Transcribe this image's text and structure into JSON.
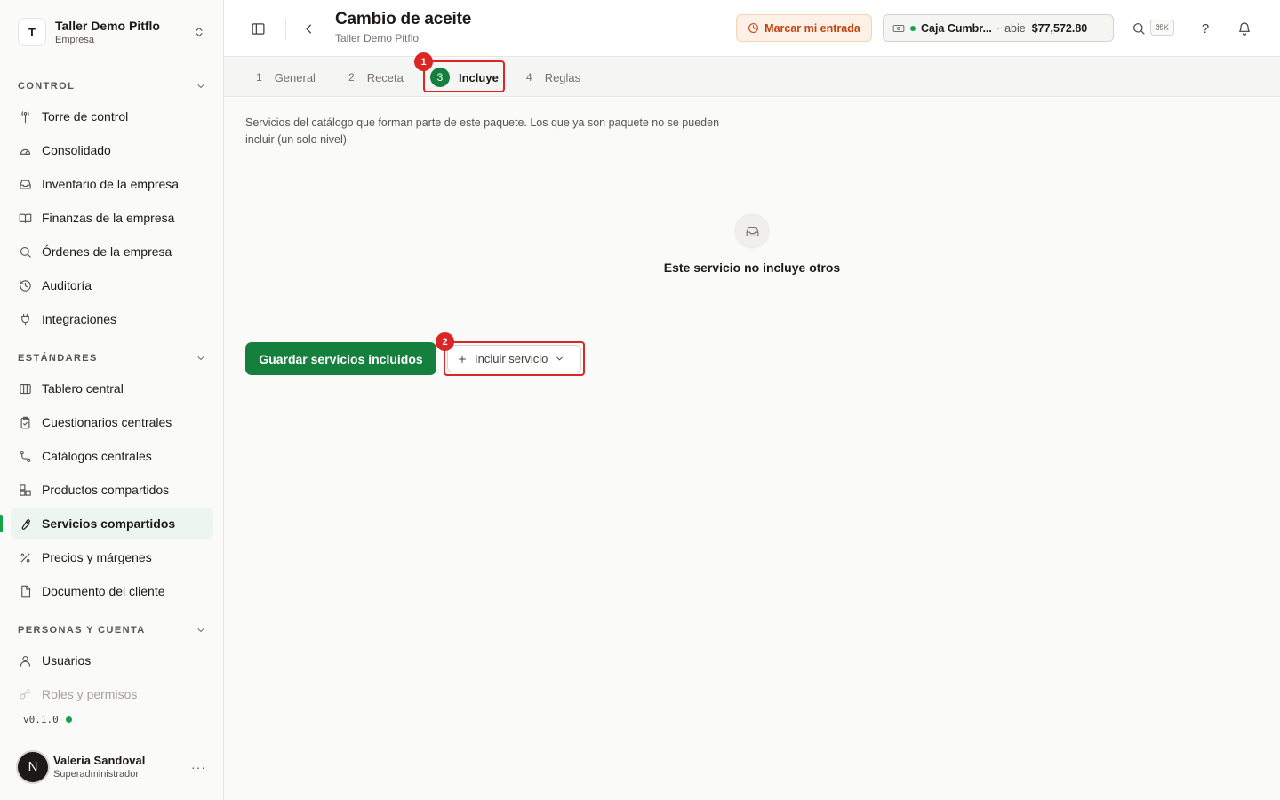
{
  "org": {
    "initial": "T",
    "name": "Taller Demo Pitflo",
    "type": "Empresa"
  },
  "sidebar": {
    "sections": [
      {
        "title": "CONTROL"
      },
      {
        "title": "ESTÁNDARES"
      },
      {
        "title": "PERSONAS Y CUENTA"
      }
    ],
    "control": [
      {
        "label": "Torre de control",
        "icon": "tower-icon"
      },
      {
        "label": "Consolidado",
        "icon": "gauge-icon"
      },
      {
        "label": "Inventario de la empresa",
        "icon": "inbox-icon"
      },
      {
        "label": "Finanzas de la empresa",
        "icon": "book-open-icon"
      },
      {
        "label": "Órdenes de la empresa",
        "icon": "search-icon"
      },
      {
        "label": "Auditoría",
        "icon": "history-icon"
      },
      {
        "label": "Integraciones",
        "icon": "plug-icon"
      }
    ],
    "standards": [
      {
        "label": "Tablero central",
        "icon": "columns-icon"
      },
      {
        "label": "Cuestionarios centrales",
        "icon": "clipboard-check-icon"
      },
      {
        "label": "Catálogos centrales",
        "icon": "route-icon"
      },
      {
        "label": "Productos compartidos",
        "icon": "boxes-icon"
      },
      {
        "label": "Servicios compartidos",
        "icon": "wrench-icon"
      },
      {
        "label": "Precios y márgenes",
        "icon": "percent-icon"
      },
      {
        "label": "Documento del cliente",
        "icon": "file-icon"
      }
    ],
    "people": [
      {
        "label": "Usuarios",
        "icon": "user-icon"
      },
      {
        "label": "Roles y permisos",
        "icon": "key-icon"
      }
    ],
    "version": "v0.1.0"
  },
  "user": {
    "initial": "N",
    "name": "Valeria Sandoval",
    "role": "Superadministrador",
    "more": "···"
  },
  "header": {
    "title": "Cambio de aceite",
    "subtitle": "Taller Demo Pitflo",
    "clock_in_label": "Marcar mi entrada",
    "cash": {
      "name": "Caja Cumbr...",
      "separator": "·",
      "status": "abie",
      "amount": "$77,572.80"
    },
    "shortcut": "⌘K",
    "help": "?"
  },
  "tabs": [
    {
      "num": "1",
      "label": "General"
    },
    {
      "num": "2",
      "label": "Receta"
    },
    {
      "num": "3",
      "label": "Incluye"
    },
    {
      "num": "4",
      "label": "Reglas"
    }
  ],
  "annotations": [
    {
      "label": "1"
    },
    {
      "label": "2"
    }
  ],
  "main": {
    "description": "Servicios del catálogo que forman parte de este paquete. Los que ya son paquete no se pueden incluir (un solo nivel).",
    "empty_text": "Este servicio no incluye otros",
    "save_label": "Guardar servicios incluidos",
    "include_label": "Incluir servicio"
  },
  "colors": {
    "accent": "#15803d",
    "annotation": "#dc2626",
    "warning_bg": "#fdf1e7",
    "warning_text": "#c2410c"
  }
}
